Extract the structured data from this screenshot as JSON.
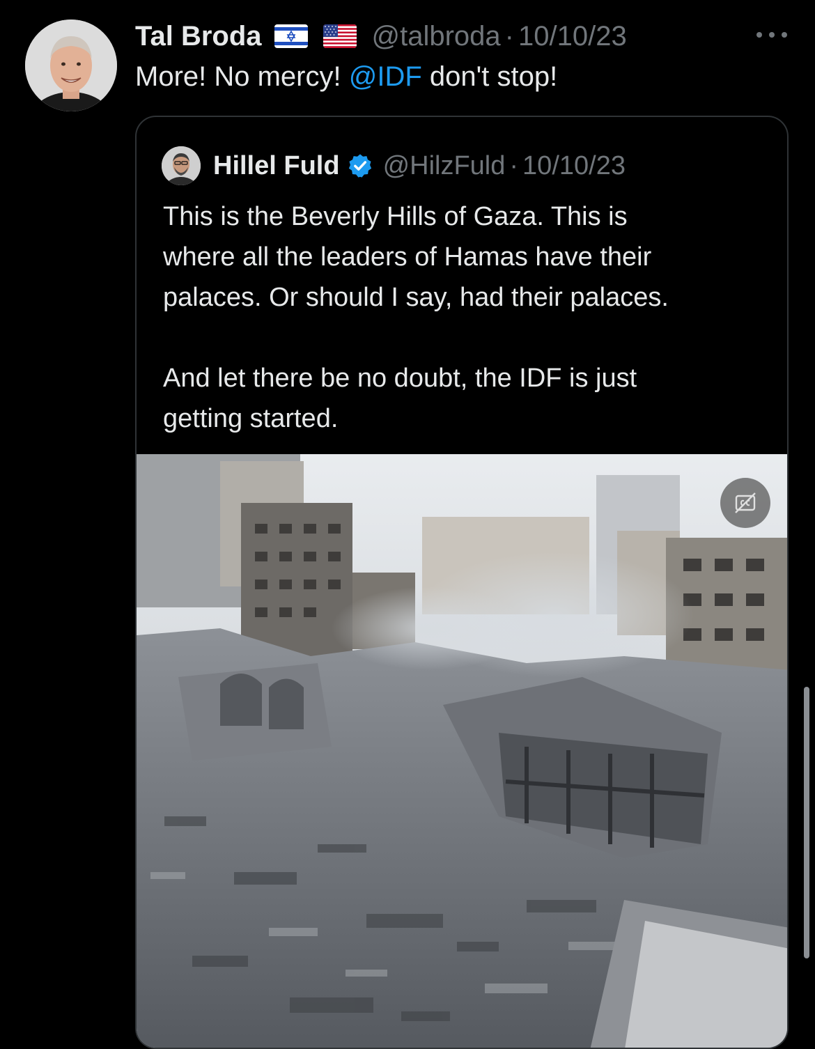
{
  "tweet": {
    "author": {
      "display_name": "Tal Broda",
      "handle": "@talbroda",
      "flags": [
        "israel-flag",
        "us-flag"
      ]
    },
    "separator": "·",
    "date": "10/10/23",
    "text_before": "More! No mercy! ",
    "mention": "@IDF",
    "text_after": " don't stop!",
    "more_icon": "more-dots-icon"
  },
  "quote": {
    "author": {
      "display_name": "Hillel Fuld",
      "handle": "@HilzFuld",
      "verified": true
    },
    "separator": "·",
    "date": "10/10/23",
    "paragraphs": [
      {
        "lines": [
          "This is the Beverly Hills of Gaza. This is",
          "where all the leaders of Hamas have their",
          "palaces. Or should I say, had their palaces."
        ]
      },
      {
        "lines": [
          "And let there be no doubt, the IDF is just",
          "getting started."
        ]
      }
    ],
    "media": {
      "kind": "video",
      "captions_button": "captions-off-icon"
    }
  },
  "colors": {
    "background": "#000000",
    "text": "#e7e9ea",
    "secondary": "#71767b",
    "link": "#1d9bf0",
    "border": "#2f3336",
    "verified": "#1d9bf0"
  }
}
